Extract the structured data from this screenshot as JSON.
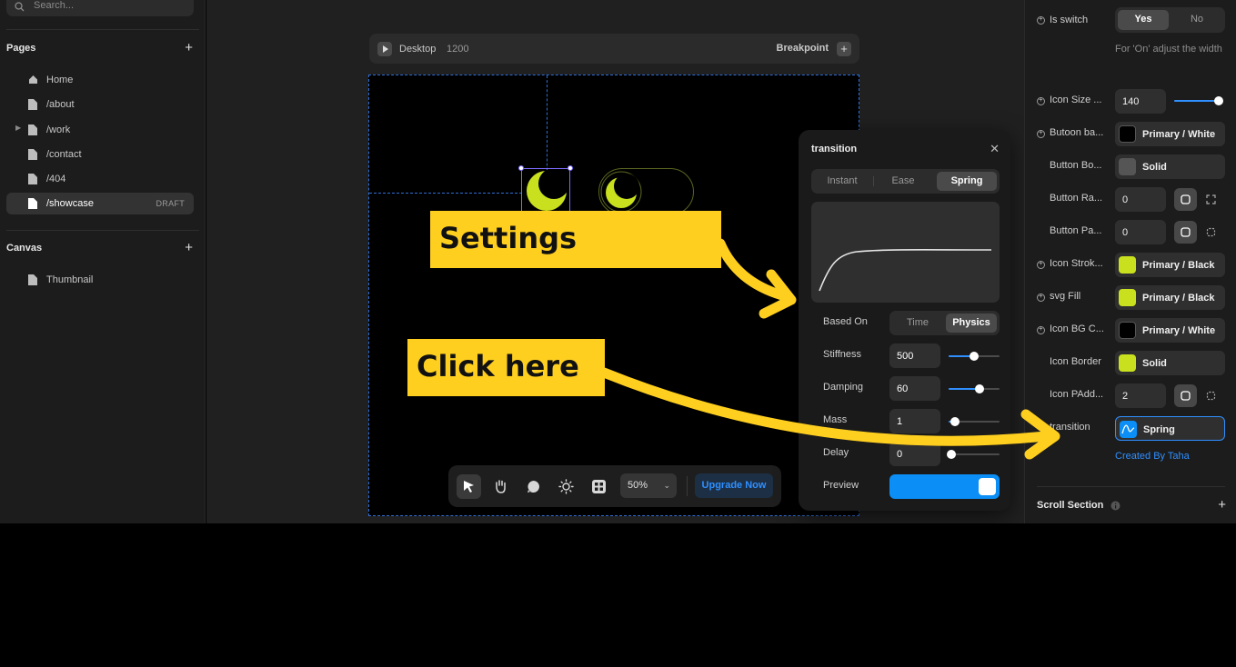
{
  "left_sidebar": {
    "search_placeholder": "Search...",
    "pages_title": "Pages",
    "pages": [
      {
        "label": "Home",
        "icon": "home-icon"
      },
      {
        "label": "/about",
        "icon": "file-icon"
      },
      {
        "label": "/work",
        "icon": "file-icon"
      },
      {
        "label": "/contact",
        "icon": "file-icon"
      },
      {
        "label": "/404",
        "icon": "file-icon"
      },
      {
        "label": "/showcase",
        "icon": "file-icon",
        "badge": "DRAFT"
      }
    ],
    "canvas_title": "Canvas",
    "canvas_items": [
      {
        "label": "Thumbnail",
        "icon": "file-icon"
      }
    ]
  },
  "breakpoint_bar": {
    "device": "Desktop",
    "width": "1200",
    "breakpoint_label": "Breakpoint"
  },
  "toolbar": {
    "zoom": "50%",
    "upgrade_label": "Upgrade Now"
  },
  "transition_popup": {
    "title": "transition",
    "types": [
      "Instant",
      "Ease",
      "Spring"
    ],
    "selected_type": "Spring",
    "based_on_label": "Based On",
    "based_on_options": [
      "Time",
      "Physics"
    ],
    "based_on_selected": "Physics",
    "stiffness_label": "Stiffness",
    "stiffness_value": "500",
    "stiffness_level": 0.5,
    "damping_label": "Damping",
    "damping_value": "60",
    "damping_level": 0.6,
    "mass_label": "Mass",
    "mass_value": "1",
    "mass_level": 0.12,
    "delay_label": "Delay",
    "delay_value": "0",
    "delay_level": 0.05,
    "preview_label": "Preview",
    "preview_on": true
  },
  "right_panel": {
    "is_switch_label": "Is switch",
    "is_switch_options": [
      "Yes",
      "No"
    ],
    "is_switch_selected": "Yes",
    "is_switch_help": "For 'On' adjust the width",
    "icon_size_label": "Icon Size ...",
    "icon_size_value": "140",
    "icon_size_level": 0.95,
    "button_bg_label": "Butoon ba...",
    "button_bg_value": "Primary / White",
    "button_border_label": "Button Bo...",
    "button_border_value": "Solid",
    "button_radius_label": "Button Ra...",
    "button_radius_value": "0",
    "button_padding_label": "Button Pa...",
    "button_padding_value": "0",
    "icon_stroke_label": "Icon Strok...",
    "icon_stroke_value": "Primary / Black",
    "svg_fill_label": "svg Fill",
    "svg_fill_value": "Primary / Black",
    "icon_bg_label": "Icon BG C...",
    "icon_bg_value": "Primary / White",
    "icon_border_label": "Icon Border",
    "icon_border_value": "Solid",
    "icon_padding_label": "Icon PAdd...",
    "icon_padding_value": "2",
    "transition_label": "transition",
    "transition_value": "Spring",
    "created_by": "Created By Taha",
    "scroll_section_label": "Scroll Section"
  },
  "annotations": {
    "settings_callout": "Settings",
    "click_callout": "Click here"
  },
  "colors": {
    "accent_blue": "#2f8fff",
    "lime": "#c8e01e",
    "callout_yellow": "#ffcf1f",
    "swatch_black": "#000000"
  }
}
